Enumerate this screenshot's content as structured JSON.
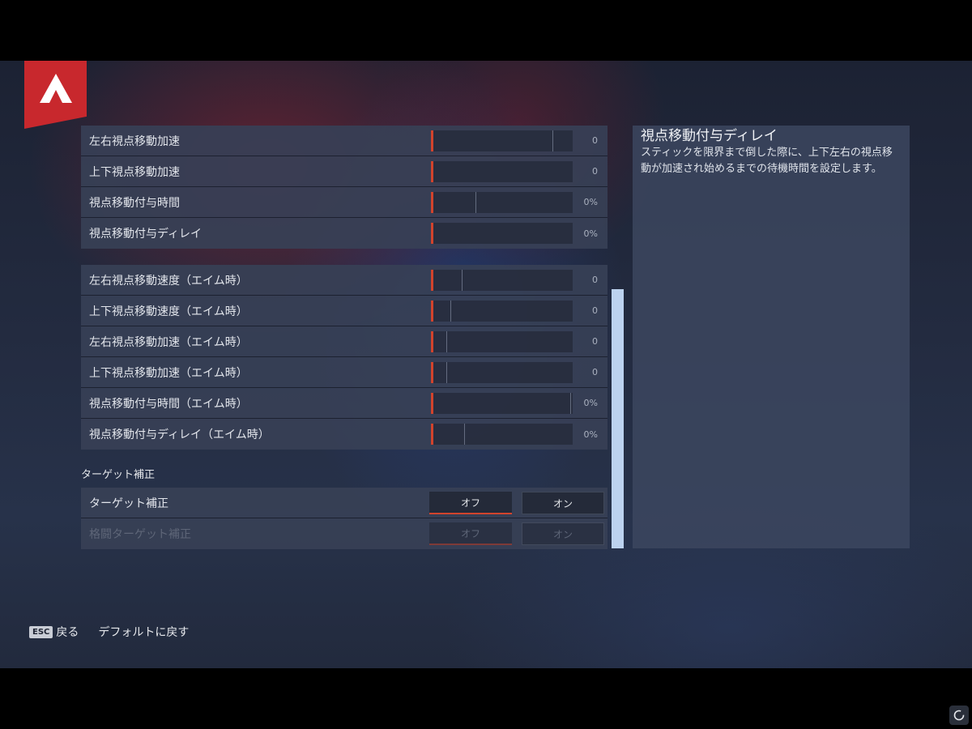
{
  "sections": {
    "group1": [
      {
        "label": "左右視点移動加速",
        "value": "0",
        "tick_fraction": 0.87
      },
      {
        "label": "上下視点移動加速",
        "value": "0",
        "tick_fraction": null
      },
      {
        "label": "視点移動付与時間",
        "value": "0%",
        "tick_fraction": 0.32
      },
      {
        "label": "視点移動付与ディレイ",
        "value": "0%",
        "tick_fraction": null
      }
    ],
    "group2": [
      {
        "label": "左右視点移動速度（エイム時）",
        "value": "0",
        "tick_fraction": 0.22
      },
      {
        "label": "上下視点移動速度（エイム時）",
        "value": "0",
        "tick_fraction": 0.14
      },
      {
        "label": "左右視点移動加速（エイム時）",
        "value": "0",
        "tick_fraction": 0.11
      },
      {
        "label": "上下視点移動加速（エイム時）",
        "value": "0",
        "tick_fraction": 0.11
      },
      {
        "label": "視点移動付与時間（エイム時）",
        "value": "0%",
        "tick_fraction": 1.0
      },
      {
        "label": "視点移動付与ディレイ（エイム時）",
        "value": "0%",
        "tick_fraction": 0.24
      }
    ],
    "target": {
      "title": "ターゲット補正",
      "rows": [
        {
          "label": "ターゲット補正",
          "off": "オフ",
          "on": "オン",
          "selected": "off",
          "disabled": false
        },
        {
          "label": "格闘ターゲット補正",
          "off": "オフ",
          "on": "オン",
          "selected": "off",
          "disabled": true
        }
      ]
    }
  },
  "description": {
    "title": "視点移動付与ディレイ",
    "body": "スティックを限界まで倒した際に、上下左右の視点移動が加速され始めるまでの待機時間を設定します。"
  },
  "footer": {
    "esc_key": "ESC",
    "back_label": "戻る",
    "default_label": "デフォルトに戻す"
  },
  "colors": {
    "accent": "#d2432c",
    "logo": "#c8282d",
    "scrollbar": "#bcd2ef"
  }
}
